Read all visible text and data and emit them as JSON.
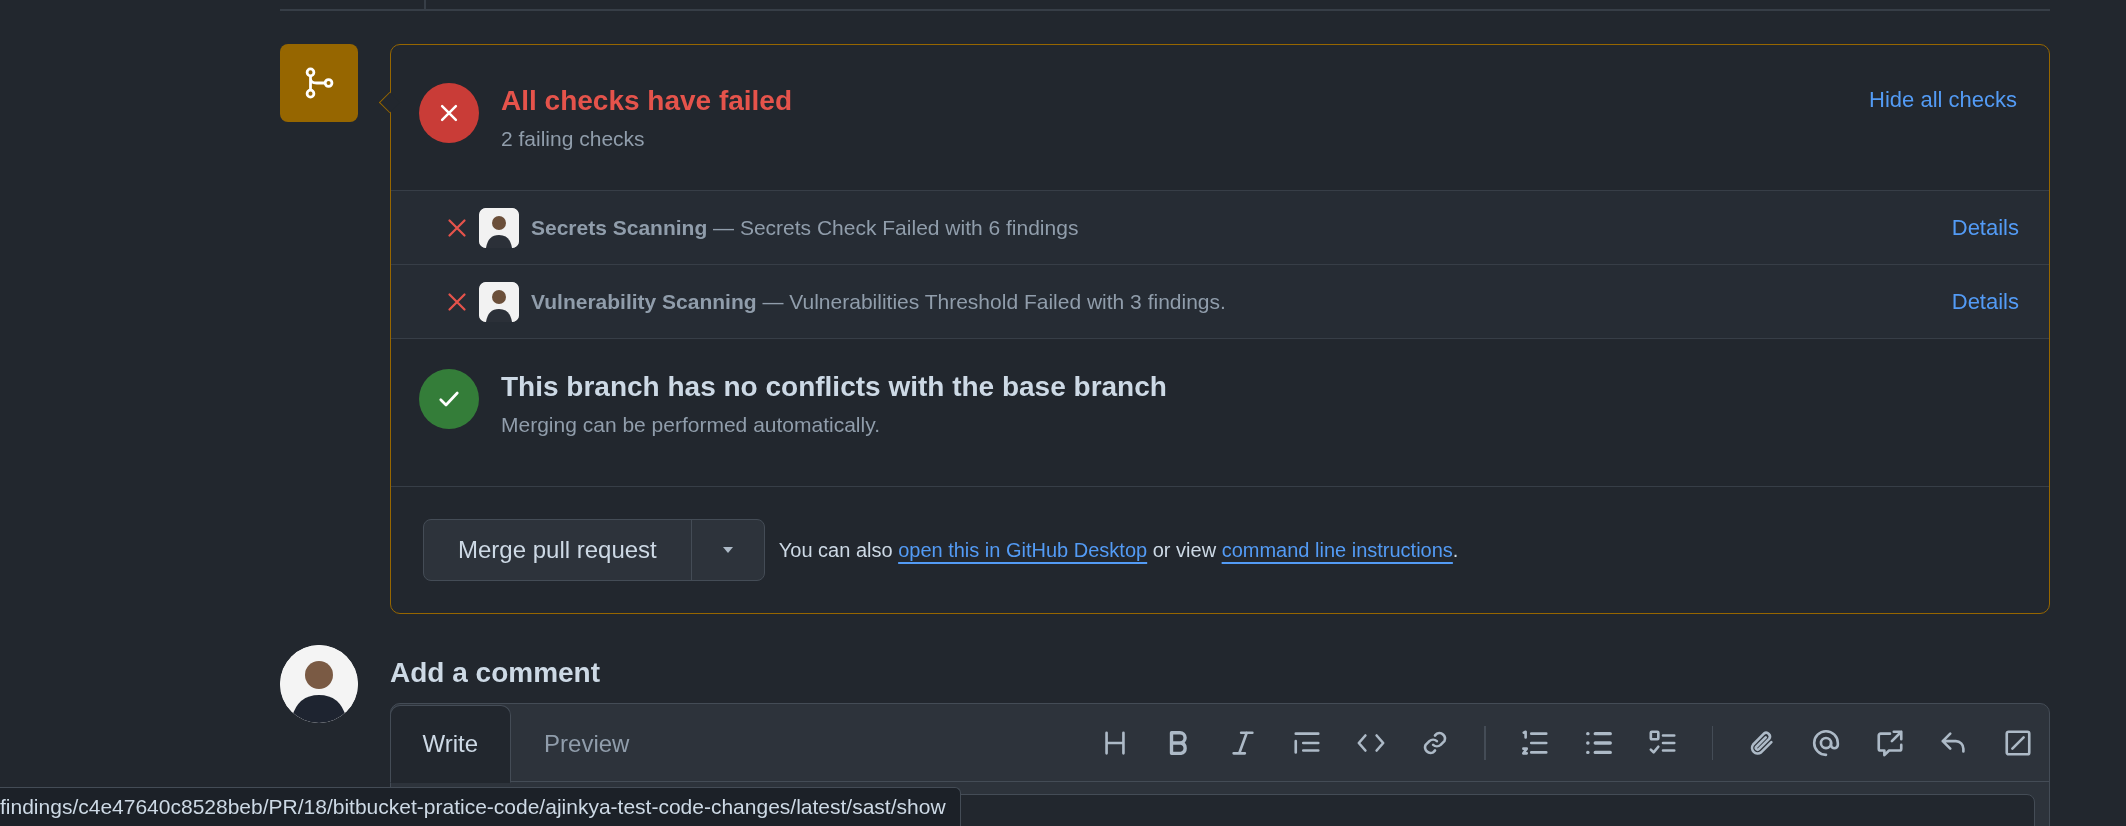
{
  "status_header": {
    "failed": true,
    "title": "All checks have failed",
    "subtitle": "2 failing checks",
    "toggle": "Hide all checks"
  },
  "checks": [
    {
      "failed": true,
      "text": "**Secrets Scanning** — Secrets Check Failed with 6 findings",
      "link": "Details"
    },
    {
      "failed": true,
      "text": "**Vulnerability Scanning** — Vulnerabilities Threshold Failed with 3 findings.",
      "link": "Details"
    }
  ],
  "conflicts": {
    "has_conflicts": false,
    "title": "This branch has no conflicts with the base branch",
    "subtitle": "Merging can be performed automatically."
  },
  "merge": {
    "button": "Merge pull request",
    "hint_before": "You can also ",
    "link_1": "open this in GitHub Desktop",
    "hint_middle": " or view ",
    "link_2": "command line instructions",
    "hint_after": "."
  },
  "comment": {
    "title": "Add a comment",
    "tabs": [
      {
        "label": "Write",
        "selected": true
      },
      {
        "label": "Preview",
        "selected": false
      }
    ]
  },
  "status_bar": {
    "url": "findings/c4e47640c8528beb/PR/18/bitbucket-pratice-code/ajinkya-test-code-changes/latest/sast/show"
  }
}
